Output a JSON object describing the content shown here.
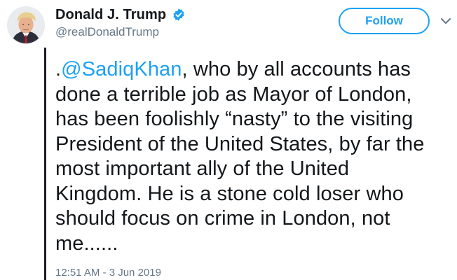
{
  "tweet": {
    "author": {
      "display_name": "Donald J. Trump",
      "handle": "@realDonaldTrump",
      "avatar_icon": "profile-photo",
      "verified_icon": "verified-badge-icon"
    },
    "follow_label": "Follow",
    "menu_icon": "chevron-down-icon",
    "text": {
      "prefix": ".",
      "mention": "@SadiqKhan",
      "line1_rest": ", who by all accounts has",
      "line2": "done a terrible job as Mayor of London,",
      "line3": "has been foolishly “nasty” to the visiting",
      "line4": "President of the United States, by far the",
      "line5": "most important ally of the United",
      "line6": "Kingdom. He is a stone cold loser who",
      "line7": "should focus on crime in London, not",
      "line8": "me......"
    },
    "timestamp": "12:51 AM - 3 Jun 2019"
  },
  "colors": {
    "accent": "#1da1f2",
    "text": "#14171a",
    "muted": "#657786",
    "bar": "#1b1e22"
  }
}
